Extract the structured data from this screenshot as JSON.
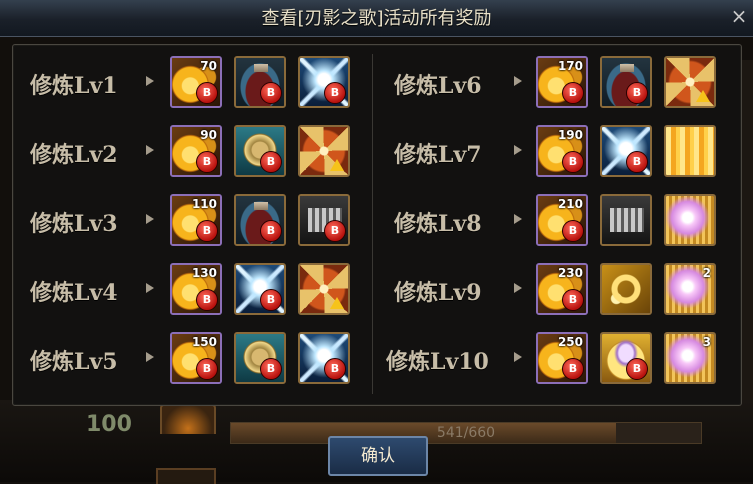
{
  "dialog": {
    "title": "查看[刃影之歌]活动所有奖励",
    "close": "×",
    "confirm_label": "确认"
  },
  "background": {
    "level_value": "100",
    "progress_text": "541/660",
    "progress_fraction": 0.82
  },
  "rows_left": [
    {
      "label": "修炼Lv1",
      "items": [
        {
          "icon": "gold-coin-icon",
          "art": "coin",
          "count": "70",
          "locked": true
        },
        {
          "icon": "potion-icon",
          "art": "potion",
          "count": "",
          "locked": true
        },
        {
          "icon": "spark-icon",
          "art": "spark",
          "count": "",
          "locked": true
        }
      ]
    },
    {
      "label": "修炼Lv2",
      "items": [
        {
          "icon": "gold-coin-icon",
          "art": "coin",
          "count": "90",
          "locked": true
        },
        {
          "icon": "medal-icon",
          "art": "medal",
          "count": "",
          "locked": true
        },
        {
          "icon": "emblem-upgrade-icon",
          "art": "emblem",
          "count": "",
          "locked": false
        }
      ]
    },
    {
      "label": "修炼Lv3",
      "items": [
        {
          "icon": "gold-coin-icon",
          "art": "coin",
          "count": "110",
          "locked": true
        },
        {
          "icon": "potion-icon",
          "art": "potion",
          "count": "",
          "locked": true
        },
        {
          "icon": "chest-icon",
          "art": "chest",
          "count": "",
          "locked": true
        }
      ]
    },
    {
      "label": "修炼Lv4",
      "items": [
        {
          "icon": "gold-coin-icon",
          "art": "coin",
          "count": "130",
          "locked": true
        },
        {
          "icon": "spark-icon",
          "art": "spark",
          "count": "",
          "locked": true
        },
        {
          "icon": "emblem-upgrade-icon",
          "art": "emblem",
          "count": "",
          "locked": false
        }
      ]
    },
    {
      "label": "修炼Lv5",
      "items": [
        {
          "icon": "gold-coin-icon",
          "art": "coin",
          "count": "150",
          "locked": true
        },
        {
          "icon": "medal-icon",
          "art": "medal",
          "count": "",
          "locked": true
        },
        {
          "icon": "spark-icon",
          "art": "spark",
          "count": "",
          "locked": true
        }
      ]
    }
  ],
  "rows_right": [
    {
      "label": "修炼Lv6",
      "items": [
        {
          "icon": "gold-coin-icon",
          "art": "coin",
          "count": "170",
          "locked": true
        },
        {
          "icon": "potion-icon",
          "art": "potion",
          "count": "",
          "locked": true
        },
        {
          "icon": "emblem-upgrade-icon",
          "art": "emblem",
          "count": "",
          "locked": false
        }
      ]
    },
    {
      "label": "修炼Lv7",
      "items": [
        {
          "icon": "gold-coin-icon",
          "art": "coin",
          "count": "190",
          "locked": true
        },
        {
          "icon": "spark-icon",
          "art": "spark",
          "count": "",
          "locked": true
        },
        {
          "icon": "golden-curtain-icon",
          "art": "curtain",
          "count": "",
          "locked": false
        }
      ]
    },
    {
      "label": "修炼Lv8",
      "items": [
        {
          "icon": "gold-coin-icon",
          "art": "coin",
          "count": "210",
          "locked": true
        },
        {
          "icon": "chest-icon",
          "art": "chest",
          "count": "",
          "locked": false
        },
        {
          "icon": "pink-gem-icon",
          "art": "gem",
          "count": "",
          "locked": false
        }
      ]
    },
    {
      "label": "修炼Lv9",
      "items": [
        {
          "icon": "gold-coin-icon",
          "art": "coin",
          "count": "230",
          "locked": true
        },
        {
          "icon": "gold-ring-icon",
          "art": "ring",
          "count": "",
          "locked": false
        },
        {
          "icon": "pink-gem-icon",
          "art": "gem",
          "count": "2",
          "locked": false
        }
      ]
    },
    {
      "label": "修炼Lv10",
      "items": [
        {
          "icon": "gold-coin-icon",
          "art": "coin",
          "count": "250",
          "locked": true
        },
        {
          "icon": "jewel-ring-icon",
          "art": "gold-ring2",
          "count": "",
          "locked": true
        },
        {
          "icon": "pink-gem-icon",
          "art": "gem",
          "count": "3",
          "locked": false
        }
      ]
    }
  ]
}
